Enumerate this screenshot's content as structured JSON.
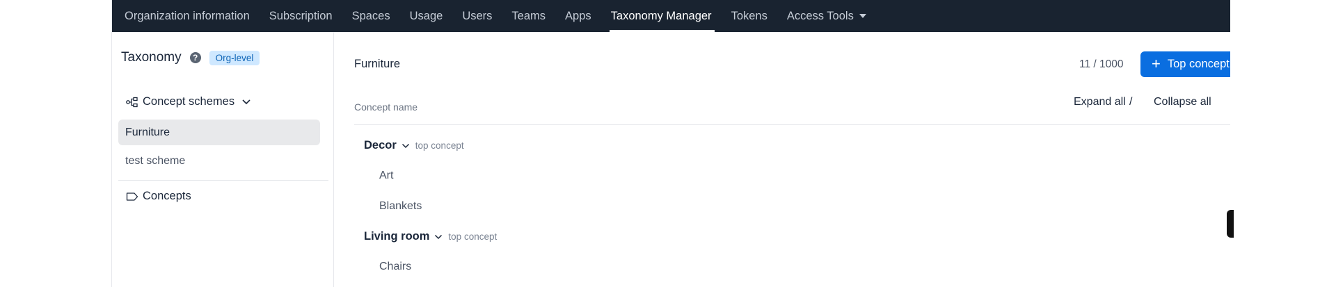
{
  "topnav": {
    "items": [
      {
        "label": "Organization information"
      },
      {
        "label": "Subscription"
      },
      {
        "label": "Spaces"
      },
      {
        "label": "Usage"
      },
      {
        "label": "Users"
      },
      {
        "label": "Teams"
      },
      {
        "label": "Apps"
      },
      {
        "label": "Taxonomy Manager",
        "active": true
      },
      {
        "label": "Tokens"
      },
      {
        "label": "Access Tools"
      }
    ]
  },
  "sidebar": {
    "title": "Taxonomy",
    "badge": "Org-level",
    "concept_schemes_label": "Concept schemes",
    "schemes": [
      "Furniture",
      "test scheme"
    ],
    "concepts_label": "Concepts"
  },
  "main": {
    "title": "Furniture",
    "counter": "11 / 1000",
    "add_button_label": "Top concept",
    "column_header": "Concept name",
    "expand_all": "Expand all",
    "separator": "/",
    "collapse_all": "Collapse all",
    "tree": [
      {
        "name": "Decor",
        "tag": "top concept",
        "children": [
          "Art",
          "Blankets"
        ]
      },
      {
        "name": "Living room",
        "tag": "top concept",
        "children": [
          "Chairs"
        ]
      }
    ]
  },
  "colors": {
    "nav_bg": "#192330",
    "accent": "#0a6ee0",
    "badge_bg": "#cfe8ff",
    "badge_text": "#1166b8",
    "selected_bg": "#e8e9eb"
  }
}
